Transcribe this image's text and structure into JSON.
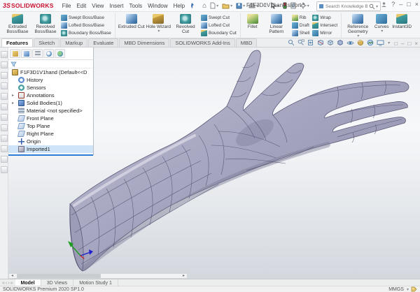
{
  "icons": {
    "home": "⌂",
    "undo": "↶",
    "caret": "▾",
    "expand": "▸",
    "scroll_left": "◂",
    "scroll_right": "▸",
    "tab_first": "«",
    "tab_prev": "‹",
    "tab_next": "›",
    "tab_last": "»",
    "minimize": "–",
    "maximize": "□",
    "restore": "□",
    "close": "×",
    "help": "?"
  },
  "titlebar": {
    "brand_mark": "3S",
    "brand": "SOLIDWORKS",
    "menus": [
      "File",
      "Edit",
      "View",
      "Insert",
      "Tools",
      "Window",
      "Help"
    ],
    "document_title": "F1F3D1V1hand.sldprt *",
    "search_placeholder": "Search Knowledge Base"
  },
  "ribbon": {
    "groups": [
      {
        "large": [
          "Extruded Boss/Base",
          "Revolved Boss/Base"
        ],
        "small": [
          "Swept Boss/Base",
          "Lofted Boss/Base",
          "Boundary Boss/Base"
        ]
      },
      {
        "large": [
          "Extruded Cut",
          "Hole Wizard",
          "Revolved Cut"
        ],
        "small": [
          "Swept Cut",
          "Lofted Cut",
          "Boundary Cut"
        ]
      },
      {
        "large": [
          "Fillet",
          "Linear Pattern"
        ],
        "small": [
          "Rib",
          "Draft",
          "Shell"
        ],
        "small2": [
          "Wrap",
          "Intersect",
          "Mirror"
        ]
      },
      {
        "large": [
          "Reference Geometry",
          "Curves",
          "Instant3D"
        ]
      }
    ]
  },
  "command_tabs": [
    {
      "label": "Features",
      "active": true
    },
    {
      "label": "Sketch"
    },
    {
      "label": "Markup"
    },
    {
      "label": "Evaluate"
    },
    {
      "label": "MBD Dimensions"
    },
    {
      "label": "SOLIDWORKS Add-Ins"
    },
    {
      "label": "MBD"
    }
  ],
  "feature_tree": {
    "root": "F1F3D1V1hand (Default<<D",
    "items": [
      "History",
      "Sensors",
      "Annotations",
      "Solid Bodies(1)",
      "Material <not specified>",
      "Front Plane",
      "Top Plane",
      "Right Plane",
      "Origin",
      "Imported1"
    ]
  },
  "bottom": {
    "doc_tabs": [
      {
        "label": "Model",
        "active": true
      },
      {
        "label": "3D Views"
      },
      {
        "label": "Motion Study 1"
      }
    ],
    "status_left": "SOLIDWORKS Premium 2020 SP1.0",
    "units": "MMGS"
  },
  "colors": {
    "brand_red": "#c8102e",
    "selection_blue": "#cfe4f7",
    "rollback_blue": "#2b7cd3",
    "model_surface": "#a4a4bf",
    "model_wire": "#50506e"
  }
}
